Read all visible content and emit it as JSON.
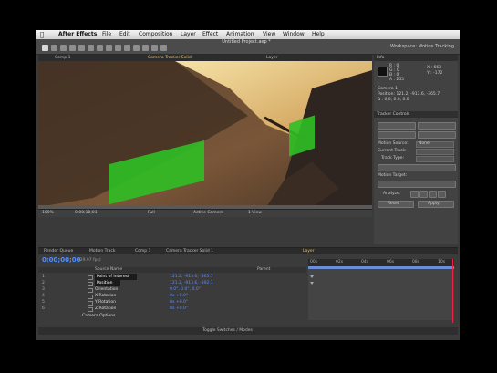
{
  "menubar": {
    "app_name": "After Effects",
    "items": [
      "File",
      "Edit",
      "Composition",
      "Layer",
      "Effect",
      "Animation",
      "View",
      "Window",
      "Help"
    ]
  },
  "window": {
    "title": "Untitled Project.aep *"
  },
  "workspace": {
    "label": "Workspace: Motion Tracking"
  },
  "comp_tabs": [
    "Comp 1",
    "Camera Tracker Solid",
    "Layer"
  ],
  "viewer_bar": {
    "zoom": "100%",
    "timecode": "0;00;10;01",
    "resolution": "Full",
    "camera": "Active Camera",
    "views": "1 View"
  },
  "info_panel": {
    "title": "Info",
    "r": "R : 0",
    "g": "G : 0",
    "b": "B : 0",
    "a": "A : 255",
    "x": "X : 663",
    "y": "Y : -172",
    "layer": "Camera 1",
    "position": "Position: 121.2, -913.6, -365.7",
    "delta": "Δ : 0.0, 0.0, 0.0"
  },
  "tracker_panel": {
    "title": "Tracker Controls",
    "motion_source_label": "Motion Source:",
    "motion_source": "None",
    "current_track_label": "Current Track:",
    "track_type_label": "Track Type:",
    "motion_target_label": "Motion Target:",
    "analyze_label": "Analyze:",
    "reset": "Reset",
    "apply": "Apply"
  },
  "timeline": {
    "tabs": [
      "Render Queue",
      "Motion Track",
      "Comp 1",
      "Camera Tracker Solid 1",
      "Layer"
    ],
    "timecode": "0;00;00;00",
    "fps": "(29.97 fps)",
    "columns": {
      "source": "Source Name",
      "parent": "Parent"
    },
    "ruler": [
      "00s",
      "02s",
      "04s",
      "06s",
      "08s",
      "10s"
    ],
    "rows": [
      {
        "idx": "1",
        "name": "Point of Interest",
        "value": "121.2, -913.6, -365.7",
        "selected": true
      },
      {
        "idx": "2",
        "name": "Position",
        "value": "121.2, -913.6, -392.1",
        "selected": true
      },
      {
        "idx": "3",
        "name": "Orientation",
        "value": "0.0°, 0.0°, 0.0°",
        "selected": false
      },
      {
        "idx": "4",
        "name": "X Rotation",
        "value": "0x +0.0°",
        "selected": false
      },
      {
        "idx": "5",
        "name": "Y Rotation",
        "value": "0x +0.0°",
        "selected": false
      },
      {
        "idx": "6",
        "name": "Z Rotation",
        "value": "0x +0.0°",
        "selected": false
      }
    ],
    "camera_options": "Camera Options",
    "toggle_modes": "Toggle Switches / Modes"
  },
  "colors": {
    "accent_blue": "#4f8fff",
    "track_green": "#2fbf25",
    "playhead": "#e22244"
  }
}
